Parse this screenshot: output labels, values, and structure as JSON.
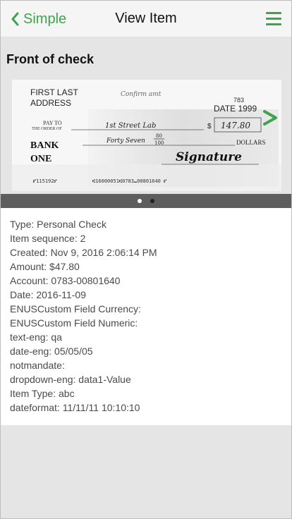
{
  "navbar": {
    "back_label": "Simple",
    "title": "View Item"
  },
  "section": {
    "title": "Front of check"
  },
  "check": {
    "name_line1": "FIRST LAST",
    "name_line2": "ADDRESS",
    "handwritten_note": "Confirm amt",
    "check_number": "783",
    "date_label": "DATE 1999",
    "pay_to_label_1": "PAY TO",
    "pay_to_label_2": "THE ORDER OF",
    "payee": "1st Street Lab",
    "dollar_sign": "$",
    "amount_box": "147.80",
    "written_amount": "Forty Seven",
    "cents_top": "80",
    "cents_bottom": "100",
    "dollars_label": "DOLLARS",
    "bank_line1": "BANK",
    "bank_line2": "ONE",
    "signature": "Signature",
    "micr_left": "⑈115192⑈",
    "micr_right": "⑆16000051⑆0783⑉00801640 ⑈"
  },
  "pager": {
    "count": 2,
    "active_index": 0
  },
  "details": [
    "Type: Personal Check",
    "Item sequence: 2",
    "Created: Nov 9, 2016 2:06:14 PM",
    "Amount: $47.80",
    "Account: 0783-00801640",
    "Date: 2016-11-09",
    "ENUSCustom Field Currency:",
    "ENUSCustom Field Numeric:",
    "text-eng: qa",
    "date-eng: 05/05/05",
    "notmandate:",
    "dropdown-eng: data1-Value",
    "Item Type: abc",
    "dateformat: 11/11/11 10:10:10"
  ],
  "colors": {
    "accent": "#3fa34d",
    "background": "#e5e5e5",
    "pager_bar": "#5e5e5e"
  }
}
